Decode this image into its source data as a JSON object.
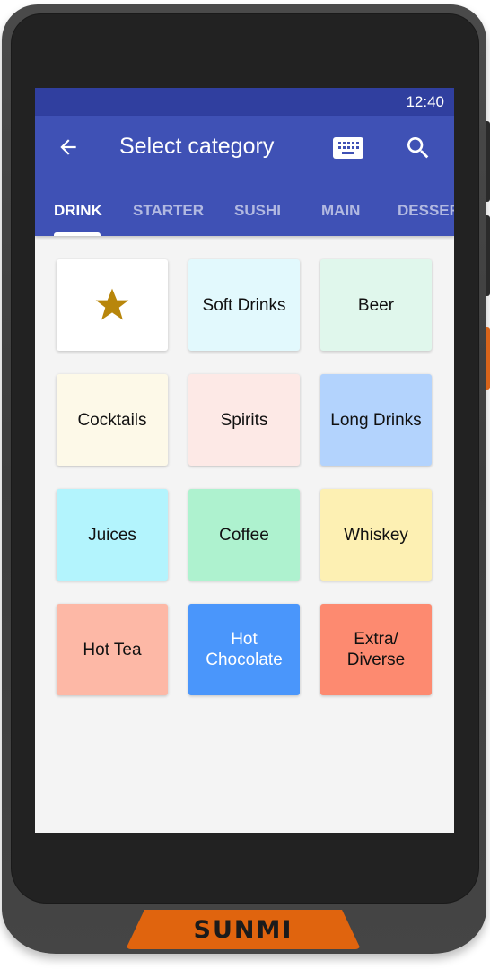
{
  "device": {
    "brand": "SUNMI"
  },
  "status_bar": {
    "time": "12:40"
  },
  "toolbar": {
    "back_icon": "arrow-left-icon",
    "title": "Select category",
    "keyboard_icon": "keyboard-icon",
    "search_icon": "search-icon"
  },
  "tabs": [
    {
      "label": "DRINK",
      "active": true
    },
    {
      "label": "STARTER",
      "active": false
    },
    {
      "label": "SUSHI",
      "active": false
    },
    {
      "label": "MAIN",
      "active": false
    },
    {
      "label": "DESSERT",
      "active": false
    }
  ],
  "colors": {
    "primary": "#3f51b5",
    "primary_dark": "#303f9f",
    "background": "#f4f4f4",
    "device_accent": "#e0640e",
    "star": "#b8860b"
  },
  "categories": [
    {
      "label": "",
      "icon": "star-icon",
      "color": "#ffffff",
      "text_color": "#111111"
    },
    {
      "label": "Soft Drinks",
      "color": "#e2f9fd",
      "text_color": "#111111"
    },
    {
      "label": "Beer",
      "color": "#e0f7ec",
      "text_color": "#111111"
    },
    {
      "label": "Cocktails",
      "color": "#fdf9e8",
      "text_color": "#111111"
    },
    {
      "label": "Spirits",
      "color": "#fde9e6",
      "text_color": "#111111"
    },
    {
      "label": "Long Drinks",
      "color": "#b3d3fd",
      "text_color": "#111111"
    },
    {
      "label": "Juices",
      "color": "#b3f4fd",
      "text_color": "#111111"
    },
    {
      "label": "Coffee",
      "color": "#aef2cf",
      "text_color": "#111111"
    },
    {
      "label": "Whiskey",
      "color": "#fdf0b3",
      "text_color": "#111111"
    },
    {
      "label": "Hot Tea",
      "color": "#fdb8a6",
      "text_color": "#111111"
    },
    {
      "label": "Hot Chocolate",
      "color": "#4a96fb",
      "text_color": "#ffffff"
    },
    {
      "label": "Extra/ Diverse",
      "color": "#fd8a70",
      "text_color": "#111111"
    }
  ]
}
